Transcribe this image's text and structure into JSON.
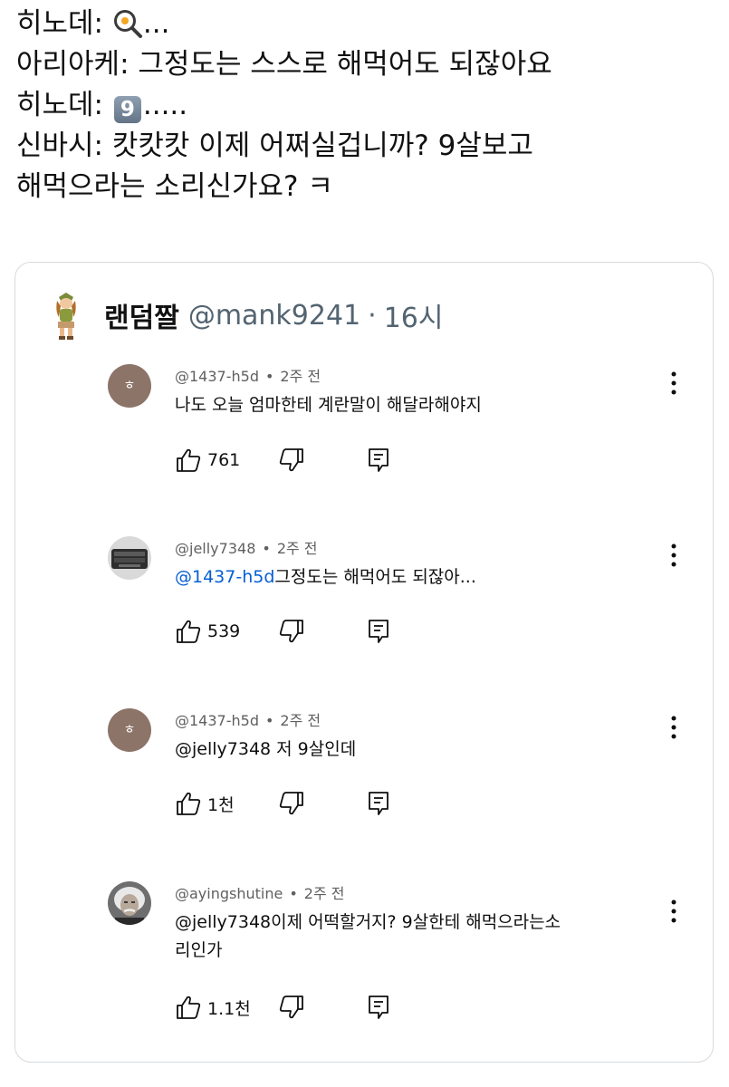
{
  "tweet": {
    "line1": {
      "speaker": "히노데:",
      "icon": "fried-egg-pan-emoji",
      "suffix": "..."
    },
    "line2": "아리아케: 그정도는 스스로 해먹어도 되잖아요",
    "line3": {
      "speaker": "히노데:",
      "keycap": "9",
      "suffix": "....."
    },
    "line4": "신바시: 캇캇캇 이제 어쩌실겁니까? 9살보고",
    "line5": "해먹으라는 소리신가요? ㅋ"
  },
  "quote": {
    "author_name": "랜덤짤",
    "author_handle": "@mank9241",
    "dot": "·",
    "time": "16시"
  },
  "comments": [
    {
      "avatar_letter": "ㅎ",
      "author": "@1437-h5d",
      "dot": "•",
      "time": "2주 전",
      "mention": "",
      "text": "나도 오늘 엄마한테 계란말이 해달라해야지",
      "likes": "761"
    },
    {
      "avatar_letter": "",
      "author": "@jelly7348",
      "dot": "•",
      "time": "2주 전",
      "mention": "@1437-h5d",
      "text": "그정도는 해먹어도 되잖아...",
      "likes": "539"
    },
    {
      "avatar_letter": "ㅎ",
      "author": "@1437-h5d",
      "dot": "•",
      "time": "2주 전",
      "mention": "",
      "text": "@jelly7348 저 9살인데",
      "likes": "1천"
    },
    {
      "avatar_letter": "",
      "author": "@ayingshutine",
      "dot": "•",
      "time": "2주 전",
      "mention": "",
      "text": "@jelly7348이제 어떡할거지? 9살한테 해먹으라는소\n리인가",
      "likes": "1.1천"
    }
  ],
  "icons": {
    "like": "thumbs-up-icon",
    "dislike": "thumbs-down-icon",
    "reply": "reply-icon",
    "more": "more-vert-icon"
  },
  "colors": {
    "mention": "#065fd4",
    "meta_text": "#606060",
    "handle": "#536471",
    "letter_avatar": "#8c7468"
  }
}
